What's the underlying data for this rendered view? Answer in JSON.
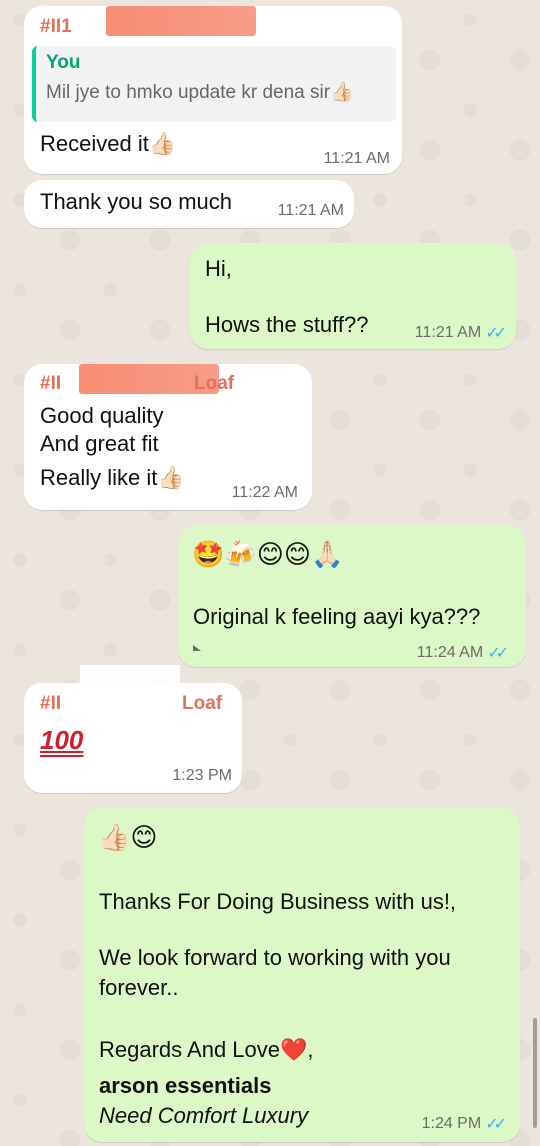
{
  "colors": {
    "chat_background": "#ece5dd",
    "incoming_bubble": "#ffffff",
    "outgoing_bubble": "#dcf8c6",
    "sender_name": "#e2705a",
    "quote_name": "#06a27a",
    "read_ticks": "#34b7f1"
  },
  "messages": [
    {
      "direction": "incoming",
      "sender": "#II1",
      "quote": {
        "name": "You",
        "text": "Mil jye to hmko update kr dena sir👍🏻"
      },
      "text": "Received it👍🏻",
      "time": "11:21 AM"
    },
    {
      "direction": "incoming",
      "text": "Thank you so much",
      "time": "11:21 AM"
    },
    {
      "direction": "outgoing",
      "line1": "Hi,",
      "line2": "Hows the stuff??",
      "time": "11:21 AM",
      "status": "read"
    },
    {
      "direction": "incoming",
      "sender": "#II",
      "sender_suffix": "Loaf",
      "line1": "Good quality",
      "line2": "And great fit",
      "line3": "Really like it👍🏻",
      "time": "11:22 AM"
    },
    {
      "direction": "outgoing",
      "emojis": "🤩🍻😊😊🙏🏻",
      "text": "Original k feeling aayi kya???",
      "time": "11:24 AM",
      "status": "read"
    },
    {
      "direction": "incoming",
      "sender": "#II",
      "sender_suffix": "Loaf",
      "text": "100",
      "time": "1:23 PM"
    },
    {
      "direction": "outgoing",
      "emojis": "👍🏻😊",
      "line1": "Thanks For Doing Business with us!,",
      "line2": "We look forward to working with you",
      "line3": "forever..",
      "line4": "Regards And Love❤️,",
      "brand": "arson essentials",
      "tagline": "Need Comfort Luxury",
      "time": "1:24 PM",
      "status": "read"
    }
  ],
  "icons": {
    "read_status": "double-check-icon"
  }
}
